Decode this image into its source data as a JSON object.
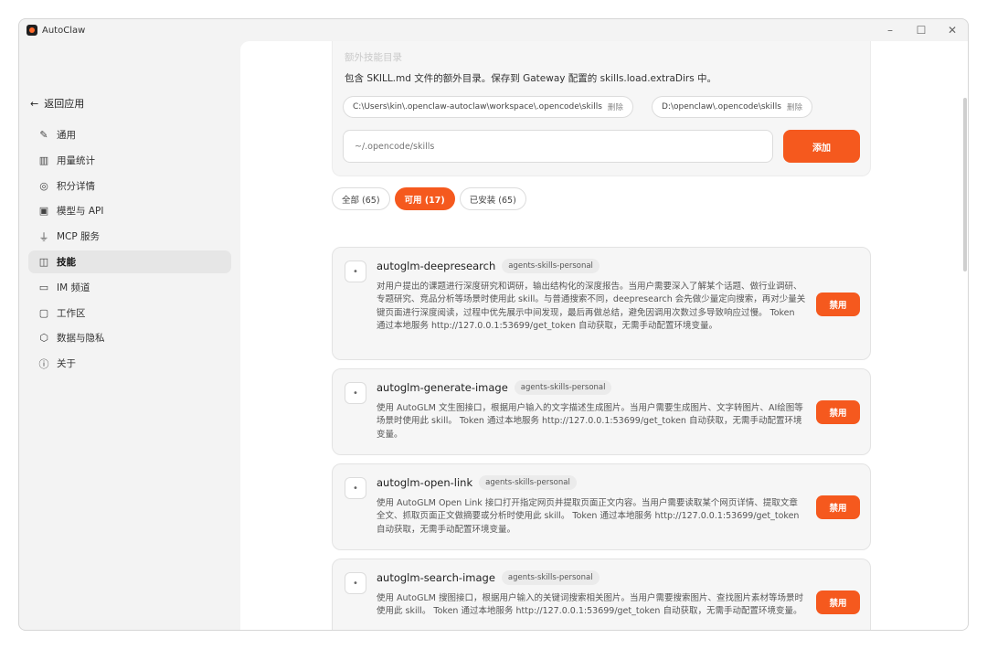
{
  "app": {
    "title": "AutoClaw"
  },
  "window_controls": {
    "minimize": "–",
    "maximize": "☐",
    "close": "✕"
  },
  "sidebar": {
    "back_label": "返回应用",
    "items": [
      {
        "label": "通用",
        "icon": "pen-icon"
      },
      {
        "label": "用量统计",
        "icon": "bar-chart-icon"
      },
      {
        "label": "积分详情",
        "icon": "coins-icon"
      },
      {
        "label": "模型与 API",
        "icon": "chip-icon"
      },
      {
        "label": "MCP 服务",
        "icon": "plug-icon"
      },
      {
        "label": "技能",
        "icon": "book-icon",
        "active": true
      },
      {
        "label": "IM 频道",
        "icon": "chat-icon"
      },
      {
        "label": "工作区",
        "icon": "folder-icon"
      },
      {
        "label": "数据与隐私",
        "icon": "shield-icon"
      },
      {
        "label": "关于",
        "icon": "info-icon"
      }
    ]
  },
  "extra_dirs": {
    "title": "额外技能目录",
    "description": "包含 SKILL.md 文件的额外目录。保存到 Gateway 配置的 skills.load.extraDirs 中。",
    "dirs": [
      {
        "path": "C:\\Users\\kin\\.openclaw-autoclaw\\workspace\\.opencode\\skills",
        "delete_label": "删除"
      },
      {
        "path": "D:\\openclaw\\.opencode\\skills",
        "delete_label": "删除"
      }
    ],
    "input_placeholder": "~/.opencode/skills",
    "add_label": "添加"
  },
  "filters": [
    {
      "label": "全部 (65)",
      "active": false
    },
    {
      "label": "可用 (17)",
      "active": true
    },
    {
      "label": "已安装 (65)",
      "active": false
    }
  ],
  "skills": [
    {
      "icon": "•",
      "name": "autoglm-deepresearch",
      "tag": "agents-skills-personal",
      "description": "对用户提出的课题进行深度研究和调研，输出结构化的深度报告。当用户需要深入了解某个话题、做行业调研、专题研究、竞品分析等场景时使用此 skill。与普通搜索不同，deepresearch 会先做少量定向搜索，再对少量关键页面进行深度阅读，过程中优先展示中间发现，最后再做总结，避免因调用次数过多导致响应过慢。 Token 通过本地服务 http://127.0.0.1:53699/get_token 自动获取，无需手动配置环境变量。",
      "action_label": "禁用"
    },
    {
      "icon": "•",
      "name": "autoglm-generate-image",
      "tag": "agents-skills-personal",
      "description": "使用 AutoGLM 文生图接口，根据用户输入的文字描述生成图片。当用户需要生成图片、文字转图片、AI绘图等场景时使用此 skill。 Token 通过本地服务 http://127.0.0.1:53699/get_token 自动获取，无需手动配置环境变量。",
      "action_label": "禁用"
    },
    {
      "icon": "•",
      "name": "autoglm-open-link",
      "tag": "agents-skills-personal",
      "description": "使用 AutoGLM Open Link 接口打开指定网页并提取页面正文内容。当用户需要读取某个网页详情、提取文章全文、抓取页面正文做摘要或分析时使用此 skill。 Token 通过本地服务 http://127.0.0.1:53699/get_token 自动获取，无需手动配置环境变量。",
      "action_label": "禁用"
    },
    {
      "icon": "•",
      "name": "autoglm-search-image",
      "tag": "agents-skills-personal",
      "description": "使用 AutoGLM 搜图接口，根据用户输入的关键词搜索相关图片。当用户需要搜索图片、查找图片素材等场景时使用此 skill。 Token 通过本地服务 http://127.0.0.1:53699/get_token 自动获取，无需手动配置环境变量。",
      "action_label": "禁用"
    }
  ],
  "colors": {
    "accent": "#f5591e",
    "sidebar_bg": "#f3f3f3",
    "card_bg": "#f6f6f6"
  }
}
